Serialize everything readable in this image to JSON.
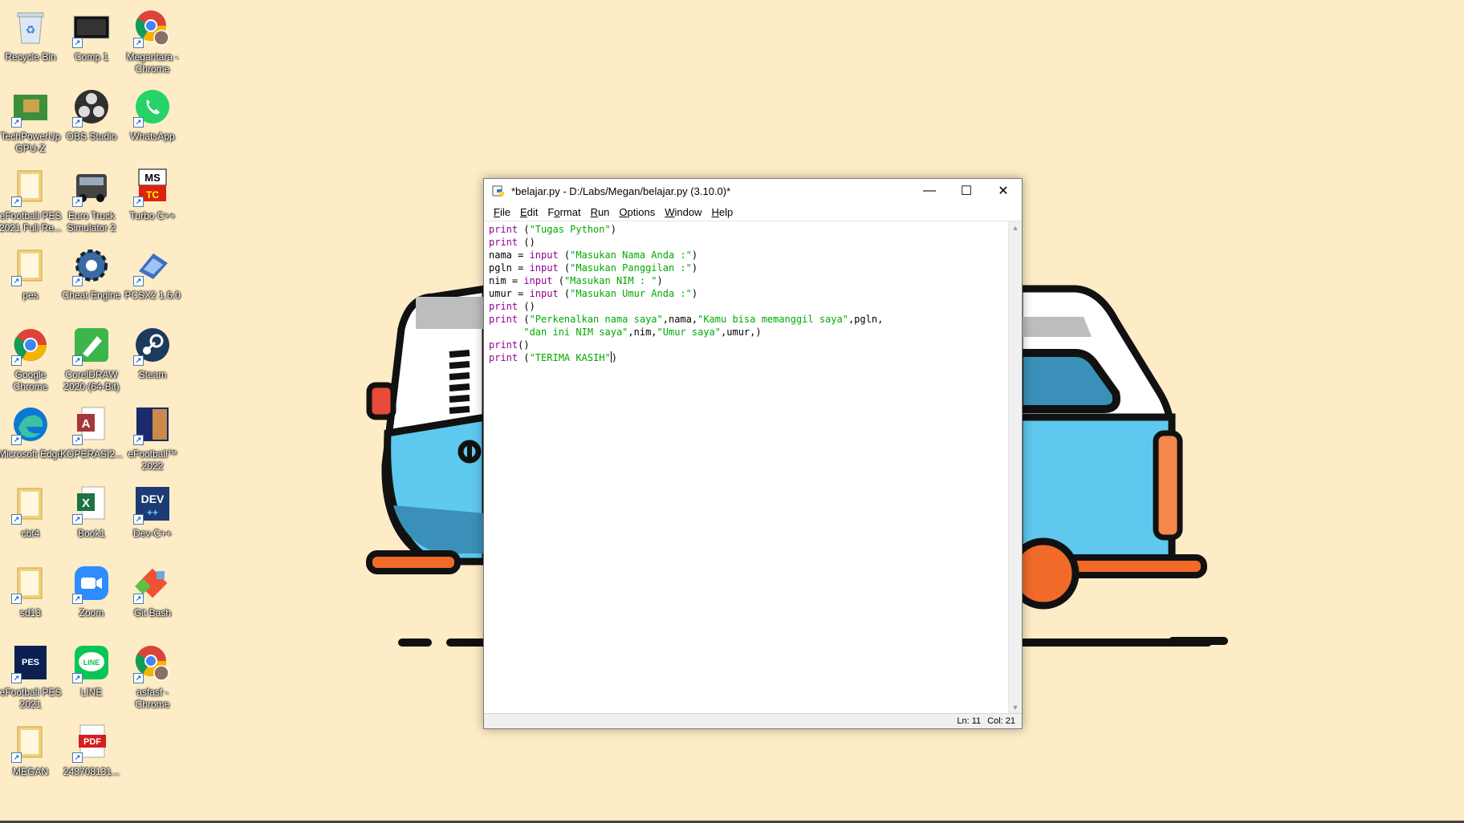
{
  "desktop": {
    "icons": [
      {
        "label": "Recycle Bin",
        "icon": "recycle-bin-icon"
      },
      {
        "label": "Comp 1",
        "icon": "video-file-icon"
      },
      {
        "label": "Megantara - Chrome",
        "icon": "chrome-profile-icon"
      },
      {
        "label": "TechPowerUp GPU-Z",
        "icon": "gpu-z-icon"
      },
      {
        "label": "OBS Studio",
        "icon": "obs-icon"
      },
      {
        "label": "WhatsApp",
        "icon": "whatsapp-icon"
      },
      {
        "label": "eFootball PES 2021 Full Re...",
        "icon": "folder-icon"
      },
      {
        "label": "Euro Truck Simulator 2",
        "icon": "truck-icon"
      },
      {
        "label": "Turbo C++",
        "icon": "turbo-cpp-icon"
      },
      {
        "label": "pes",
        "icon": "folder-icon"
      },
      {
        "label": "Cheat Engine",
        "icon": "cheat-engine-icon"
      },
      {
        "label": "PCSX2 1.6.0",
        "icon": "pcsx2-icon"
      },
      {
        "label": "Google Chrome",
        "icon": "chrome-icon"
      },
      {
        "label": "CorelDRAW 2020 (64-Bit)",
        "icon": "coreldraw-icon"
      },
      {
        "label": "Steam",
        "icon": "steam-icon"
      },
      {
        "label": "Microsoft Edge",
        "icon": "edge-icon"
      },
      {
        "label": "KOPERASI2...",
        "icon": "access-file-icon"
      },
      {
        "label": "eFootball™ 2022",
        "icon": "efootball-icon"
      },
      {
        "label": "cbt4",
        "icon": "folder-icon"
      },
      {
        "label": "Book1",
        "icon": "excel-file-icon"
      },
      {
        "label": "Dev-C++",
        "icon": "devcpp-icon"
      },
      {
        "label": "sd13",
        "icon": "folder-icon"
      },
      {
        "label": "Zoom",
        "icon": "zoom-icon"
      },
      {
        "label": "Git Bash",
        "icon": "git-icon"
      },
      {
        "label": "eFootball PES 2021",
        "icon": "pes-icon"
      },
      {
        "label": "LINE",
        "icon": "line-icon"
      },
      {
        "label": "asfasf - Chrome",
        "icon": "chrome-profile-icon"
      },
      {
        "label": "MEGAN",
        "icon": "folder-icon"
      },
      {
        "label": "243708131...",
        "icon": "pdf-file-icon"
      }
    ]
  },
  "window": {
    "title": "*belajar.py - D:/Labs/Megan/belajar.py (3.10.0)*",
    "minimize": "—",
    "maximize": "☐",
    "close": "✕",
    "menu": [
      {
        "key": "F",
        "rest": "ile"
      },
      {
        "key": "E",
        "rest": "dit"
      },
      {
        "key": "",
        "pre": "F",
        "key2": "o",
        "rest": "rmat"
      },
      {
        "key": "R",
        "rest": "un"
      },
      {
        "key": "O",
        "rest": "ptions"
      },
      {
        "key": "W",
        "rest": "indow"
      },
      {
        "key": "H",
        "rest": "elp"
      }
    ],
    "status": {
      "line": "Ln: 11",
      "col": "Col: 21"
    }
  },
  "code": [
    [
      [
        "print",
        "bi"
      ],
      [
        " (",
        ""
      ],
      [
        "\"Tugas Python\"",
        "str"
      ],
      [
        ")",
        ""
      ]
    ],
    [
      [
        "print",
        "bi"
      ],
      [
        " ()",
        ""
      ]
    ],
    [
      [
        "nama = ",
        ""
      ],
      [
        "input",
        "bi"
      ],
      [
        " (",
        ""
      ],
      [
        "\"Masukan Nama Anda :\"",
        "str"
      ],
      [
        ")",
        ""
      ]
    ],
    [
      [
        "pgln = ",
        ""
      ],
      [
        "input",
        "bi"
      ],
      [
        " (",
        ""
      ],
      [
        "\"Masukan Panggilan :\"",
        "str"
      ],
      [
        ")",
        ""
      ]
    ],
    [
      [
        "nim = ",
        ""
      ],
      [
        "input",
        "bi"
      ],
      [
        " (",
        ""
      ],
      [
        "\"Masukan NIM : \"",
        "str"
      ],
      [
        ")",
        ""
      ]
    ],
    [
      [
        "umur = ",
        ""
      ],
      [
        "input",
        "bi"
      ],
      [
        " (",
        ""
      ],
      [
        "\"Masukan Umur Anda :\"",
        "str"
      ],
      [
        ")",
        ""
      ]
    ],
    [
      [
        "print",
        "bi"
      ],
      [
        " ()",
        ""
      ]
    ],
    [
      [
        "print",
        "bi"
      ],
      [
        " (",
        ""
      ],
      [
        "\"Perkenalkan nama saya\"",
        "str"
      ],
      [
        ",nama,",
        ""
      ],
      [
        "\"Kamu bisa memanggil saya\"",
        "str"
      ],
      [
        ",pgln,",
        ""
      ]
    ],
    [
      [
        "      ",
        ""
      ],
      [
        "\"dan ini NIM saya\"",
        "str"
      ],
      [
        ",nim,",
        ""
      ],
      [
        "\"Umur saya\"",
        "str"
      ],
      [
        ",umur,)",
        ""
      ]
    ],
    [
      [
        "print",
        "bi"
      ],
      [
        "()",
        ""
      ]
    ],
    [
      [
        "print",
        "bi"
      ],
      [
        " (",
        ""
      ],
      [
        "\"TERIMA KASIH\"",
        "str"
      ],
      [
        "CARET",
        "caret"
      ],
      [
        ")",
        ""
      ]
    ]
  ]
}
